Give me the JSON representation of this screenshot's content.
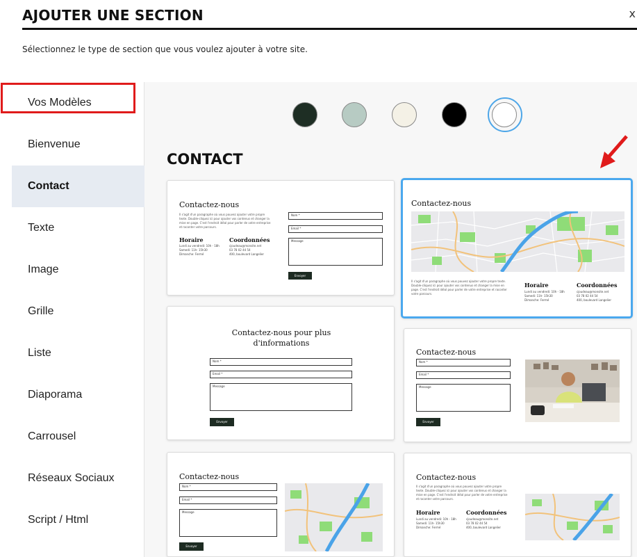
{
  "header": {
    "title": "AJOUTER UNE SECTION",
    "close_label": "x",
    "subtitle": "Sélectionnez le type de section que vous voulez ajouter à votre site."
  },
  "sidebar": {
    "items": [
      {
        "label": "Vos Modèles",
        "active": false
      },
      {
        "label": "Bienvenue",
        "active": false
      },
      {
        "label": "Contact",
        "active": true
      },
      {
        "label": "Texte",
        "active": false
      },
      {
        "label": "Image",
        "active": false
      },
      {
        "label": "Grille",
        "active": false
      },
      {
        "label": "Liste",
        "active": false
      },
      {
        "label": "Diaporama",
        "active": false
      },
      {
        "label": "Carrousel",
        "active": false
      },
      {
        "label": "Réseaux Sociaux",
        "active": false
      },
      {
        "label": "Script / Html",
        "active": false
      }
    ]
  },
  "colors": {
    "swatches": [
      "#1e2e24",
      "#b7cbc3",
      "#f4f1e6",
      "#000000",
      "#ffffff"
    ],
    "selected_swatch": "#ffffff",
    "accent": "#4aa8ee",
    "highlight": "#e01b1b"
  },
  "main": {
    "section_heading": "CONTACT"
  },
  "templates": {
    "contact_title": "Contactez-nous",
    "contact_title_long": "Contactez-nous pour plus d'informations",
    "paragraph": "Il s'agit d'un paragraphe où vous pouvez ajouter votre propre texte. Double-cliquez ici pour ajouter vos contenus et changer la mise en page. C'est l'endroit idéal pour parler de votre entreprise et raconter votre parcours.",
    "hours_heading": "Horaire",
    "hours_lines": [
      "Lundi au vendredi: 10h - 18h",
      "Samedi: 11h- 15h30",
      "Dimanche: Fermé"
    ],
    "contact_heading": "Coordonnées",
    "contact_lines": [
      "cjoudeau@monsite.net",
      "03 78 02 44 54",
      "400, boulevard Langelier"
    ],
    "field_name": "Nom *",
    "field_email": "Email *",
    "field_message": "Message",
    "send_label": "Envoyer"
  }
}
